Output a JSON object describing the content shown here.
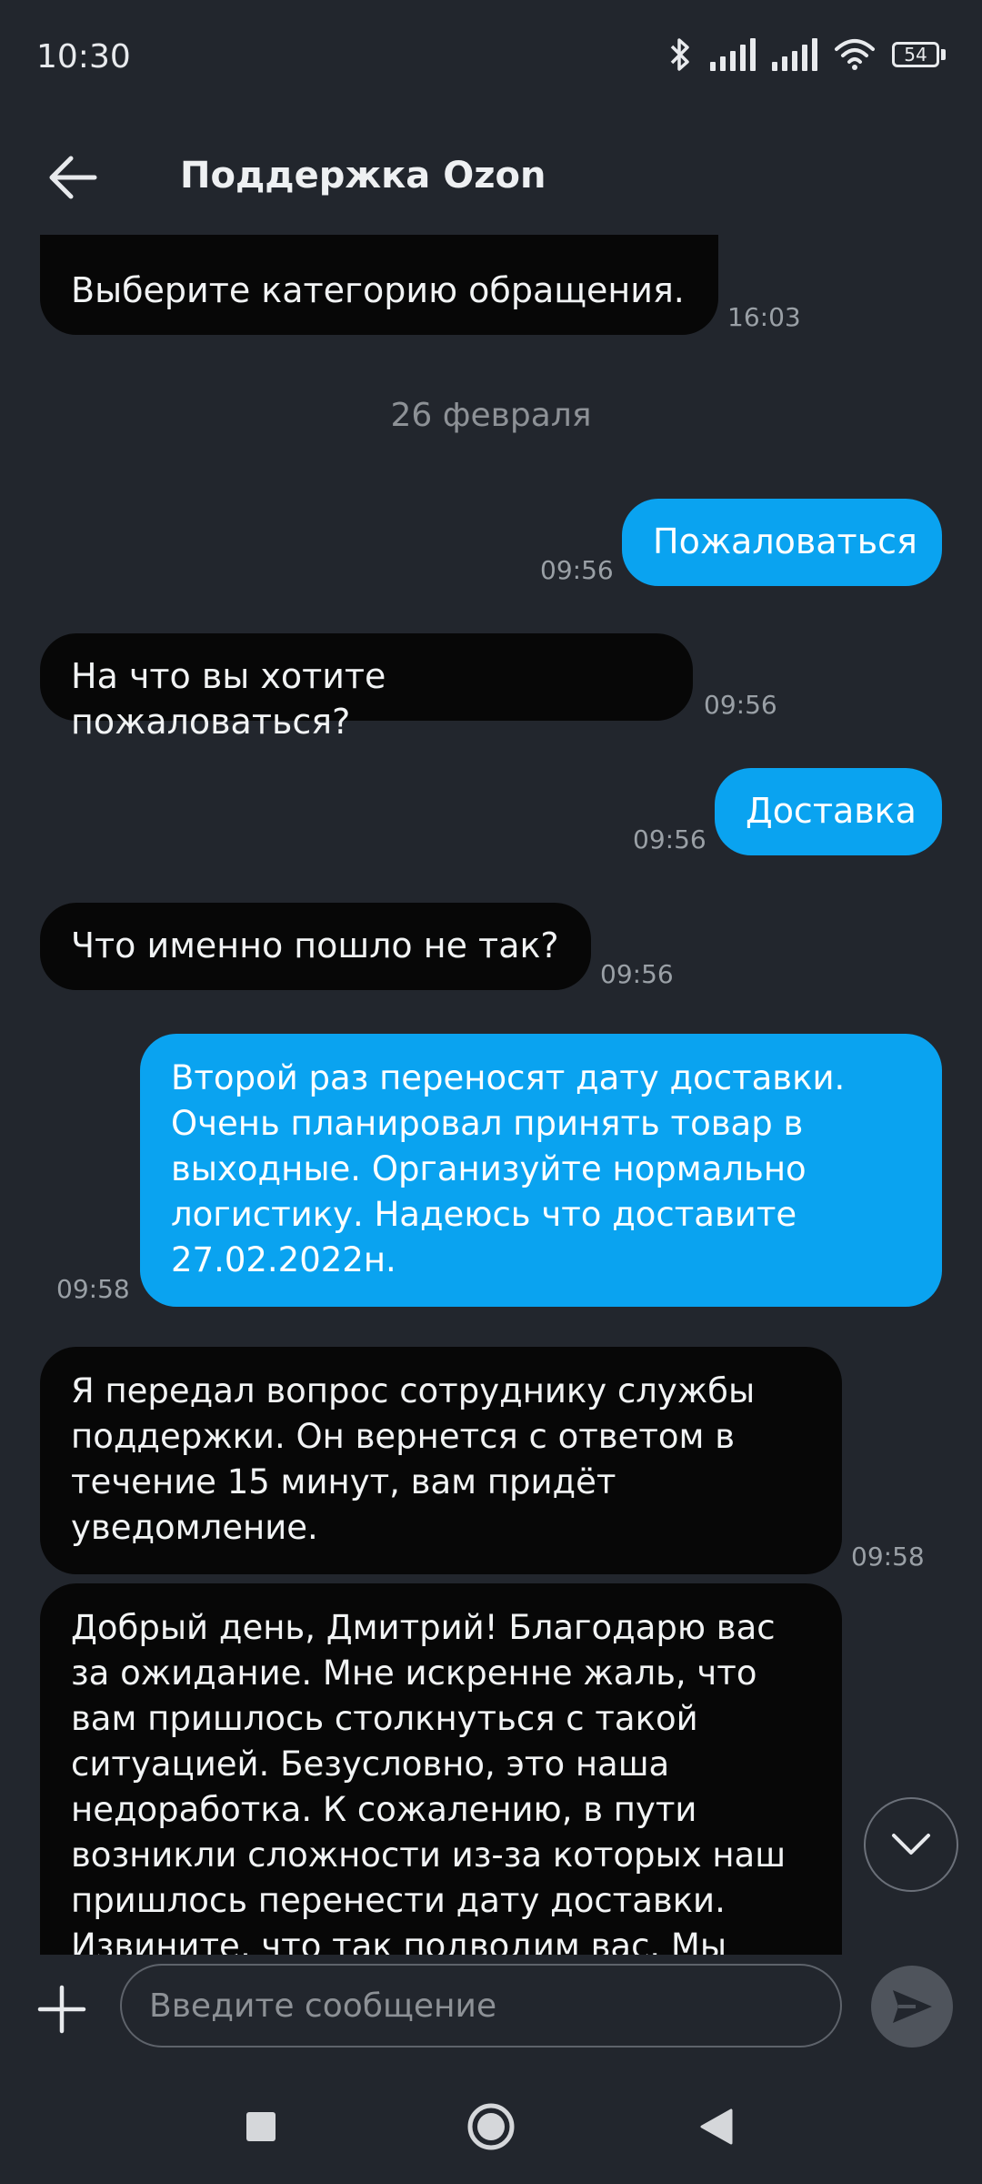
{
  "status_bar": {
    "time": "10:30",
    "battery": "54"
  },
  "header": {
    "title": "Поддержка Ozon"
  },
  "chat": {
    "messages": [
      {
        "text": "Выберите категорию обращения.",
        "time": "16:03"
      },
      {
        "text": "Пожаловаться",
        "time": "09:56"
      },
      {
        "text": "На что вы хотите пожаловаться?",
        "time": "09:56"
      },
      {
        "text": "Доставка",
        "time": "09:56"
      },
      {
        "text": "Что именно пошло не так?",
        "time": "09:56"
      },
      {
        "text": "Второй раз переносят дату доставки. Очень планировал принять товар в выходные. Организуйте нормально логистику. Надеюсь что доставите 27.02.2022н.",
        "time": "09:58"
      },
      {
        "text": "Я передал вопрос сотруднику службы поддержки. Он вернется с ответом в течение 15 минут, вам придёт уведомление.",
        "time": "09:58"
      },
      {
        "text": "Добрый день, Дмитрий! Благодарю вас за ожидание. Мне искренне жаль, что вам пришлось столкнуться с такой ситуацией. Безусловно, это наша недоработка. К сожалению, в пути возникли сложности из-за которых наш пришлось перенести дату доставки. Извините, что так подводим вас. Мы",
        "time": ""
      }
    ],
    "date_separator": "26 февраля"
  },
  "composer": {
    "placeholder": "Введите сообщение"
  },
  "colors": {
    "background": "#22262d",
    "incoming_bubble": "#070707",
    "outgoing_bubble": "#0aa3f0"
  },
  "icons": {
    "back": "arrow-left-icon",
    "scroll_down": "chevron-down-icon",
    "add": "plus-icon",
    "send": "send-icon",
    "nav_recent": "square-icon",
    "nav_home": "circle-icon",
    "nav_back": "triangle-left-icon"
  }
}
